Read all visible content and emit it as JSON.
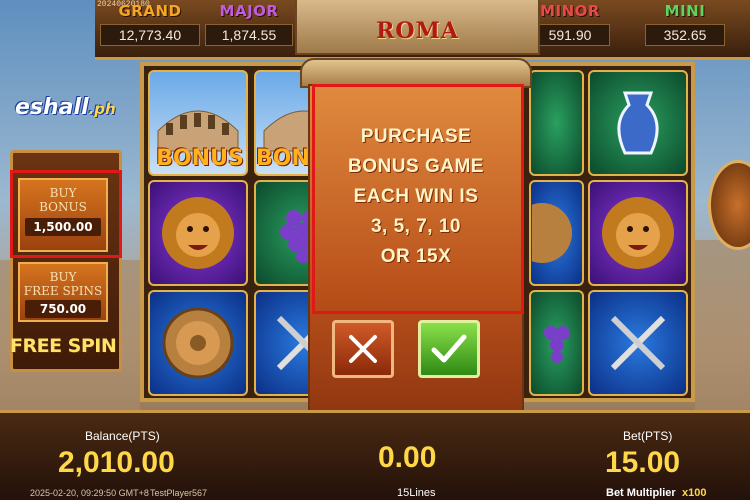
{
  "header": {
    "timestamp_code": "20240620180",
    "game_title": "ROMA",
    "jackpots": [
      {
        "label": "GRAND",
        "value": "12,773.40",
        "color": "#f5a623"
      },
      {
        "label": "MAJOR",
        "value": "1,874.55",
        "color": "#c25be0"
      },
      {
        "label": "MINOR",
        "value": "591.90",
        "color": "#e84a4a"
      },
      {
        "label": "MINI",
        "value": "352.65",
        "color": "#5fd35f"
      }
    ]
  },
  "logo": {
    "brand": "eshall",
    "suffix": ".ph"
  },
  "left_panel": {
    "buy_bonus": {
      "label": "BUY\nBONUS",
      "amount": "1,500.00"
    },
    "buy_free_spins": {
      "label": "BUY\nFREE SPINS",
      "amount": "750.00"
    },
    "free_spin_label": "FREE SPIN"
  },
  "reels": {
    "bonus_label": "BONUS",
    "partial_bonus_label": "BON"
  },
  "modal": {
    "message": "PURCHASE\nBONUS GAME\nEACH WIN IS\n3, 5, 7, 10\nOR 15X",
    "cancel_icon": "x-icon",
    "confirm_icon": "checkmark-icon"
  },
  "bottom_bar": {
    "balance_label": "Balance(PTS)",
    "balance_value": "2,010.00",
    "win_value": "0.00",
    "lines_label": "15Lines",
    "bet_label": "Bet(PTS)",
    "bet_value": "15.00",
    "bet_multiplier_label": "Bet Multiplier",
    "bet_multiplier_value": "x100",
    "datetime": "2025-02-20, 09:29:50 GMT+8",
    "player": "TestPlayer567"
  },
  "colors": {
    "highlight": "#e01818",
    "gold": "#ffd84a"
  }
}
